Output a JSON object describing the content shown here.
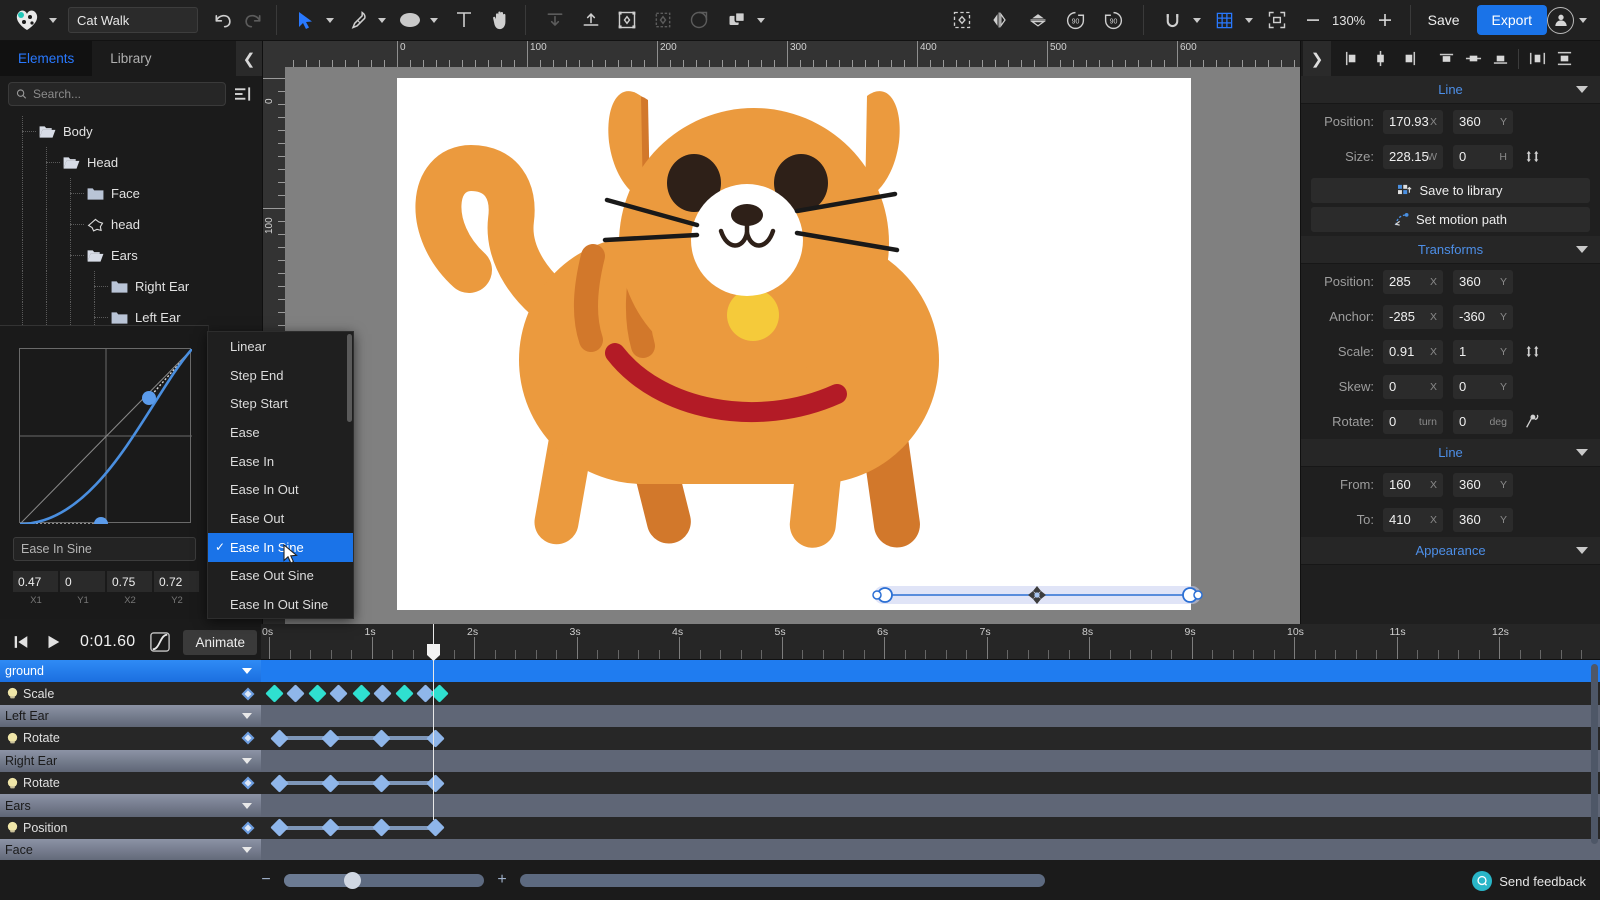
{
  "app": {
    "project_title": "Cat Walk",
    "save_label": "Save",
    "export_label": "Export",
    "zoom_level": "130%",
    "zoom_minus": "−",
    "zoom_plus": "+"
  },
  "left_panel": {
    "tabs": [
      {
        "label": "Elements",
        "selected": true
      },
      {
        "label": "Library",
        "selected": false
      }
    ],
    "search_placeholder": "Search...",
    "search_value": "",
    "tree": [
      {
        "label": "Body",
        "depth": 0,
        "icon": "folder-open-icon"
      },
      {
        "label": "Head",
        "depth": 1,
        "icon": "folder-open-icon"
      },
      {
        "label": "Face",
        "depth": 2,
        "icon": "folder-closed-icon"
      },
      {
        "label": "head",
        "depth": 2,
        "icon": "shape-star-icon"
      },
      {
        "label": "Ears",
        "depth": 2,
        "icon": "folder-open-icon"
      },
      {
        "label": "Right Ear",
        "depth": 3,
        "icon": "folder-closed-icon"
      },
      {
        "label": "Left Ear",
        "depth": 3,
        "icon": "folder-closed-icon"
      }
    ]
  },
  "easing_editor": {
    "name_value": "Ease In Sine",
    "bezier": [
      {
        "value": "0.47",
        "label": "X1"
      },
      {
        "value": "0",
        "label": "Y1"
      },
      {
        "value": "0.75",
        "label": "X2"
      },
      {
        "value": "0.72",
        "label": "Y2"
      }
    ]
  },
  "easing_dropdown": {
    "selected": "Ease In Sine",
    "items": [
      "Linear",
      "Step End",
      "Step Start",
      "Ease",
      "Ease In",
      "Ease In Out",
      "Ease Out",
      "Ease In Sine",
      "Ease Out Sine",
      "Ease In Out Sine"
    ]
  },
  "canvas": {
    "ruler_h_labels": [
      "0",
      "100",
      "200",
      "300",
      "400",
      "500",
      "600"
    ],
    "ruler_v_labels": [
      "0",
      "100"
    ]
  },
  "right_panel": {
    "sections": [
      {
        "title": "Line",
        "rows": [
          {
            "label": "Position:",
            "x": "170.93",
            "y": "360",
            "ux": "X",
            "uy": "Y",
            "link": false
          },
          {
            "label": "Size:",
            "x": "228.15",
            "y": "0",
            "ux": "W",
            "uy": "H",
            "link": true
          }
        ],
        "buttons": [
          {
            "label": "Save to library",
            "icon": "save-library-icon"
          },
          {
            "label": "Set motion path",
            "icon": "motion-path-icon"
          }
        ]
      },
      {
        "title": "Transforms",
        "rows": [
          {
            "label": "Position:",
            "x": "285",
            "y": "360",
            "ux": "X",
            "uy": "Y",
            "link": false
          },
          {
            "label": "Anchor:",
            "x": "-285",
            "y": "-360",
            "ux": "X",
            "uy": "Y",
            "link": false
          },
          {
            "label": "Scale:",
            "x": "0.91",
            "y": "1",
            "ux": "X",
            "uy": "Y",
            "link": true
          },
          {
            "label": "Skew:",
            "x": "0",
            "y": "0",
            "ux": "X",
            "uy": "Y",
            "link": false
          },
          {
            "label": "Rotate:",
            "x": "0",
            "y": "0",
            "ux": "turn",
            "uy": "deg",
            "link": true
          }
        ],
        "buttons": []
      },
      {
        "title": "Line",
        "rows": [
          {
            "label": "From:",
            "x": "160",
            "y": "360",
            "ux": "X",
            "uy": "Y",
            "link": false
          },
          {
            "label": "To:",
            "x": "410",
            "y": "360",
            "ux": "X",
            "uy": "Y",
            "link": false
          }
        ],
        "buttons": []
      },
      {
        "title": "Appearance",
        "rows": [],
        "buttons": []
      }
    ]
  },
  "timeline": {
    "current_time": "0:01.60",
    "animate_label": "Animate",
    "ruler_labels": [
      "0s",
      "1s",
      "2s",
      "3s",
      "4s",
      "5s",
      "6s",
      "7s",
      "8s",
      "9s",
      "10s",
      "11s",
      "12s"
    ],
    "playhead_seconds": 1.6,
    "rows": [
      {
        "name": "ground",
        "type": "group",
        "selected": true
      },
      {
        "name": "Scale",
        "type": "prop",
        "keyframes_s": [
          0.05,
          0.26,
          0.47,
          0.68,
          0.9,
          1.11,
          1.32,
          1.53,
          1.66
        ],
        "alt_colors": true,
        "connect": false
      },
      {
        "name": "Left Ear",
        "type": "group",
        "selected": false
      },
      {
        "name": "Rotate",
        "type": "prop",
        "keyframes_s": [
          0.1,
          0.6,
          1.1,
          1.62
        ],
        "alt_colors": false,
        "connect": true
      },
      {
        "name": "Right Ear",
        "type": "group",
        "selected": false
      },
      {
        "name": "Rotate",
        "type": "prop",
        "keyframes_s": [
          0.1,
          0.6,
          1.1,
          1.62
        ],
        "alt_colors": false,
        "connect": true
      },
      {
        "name": "Ears",
        "type": "group",
        "selected": false
      },
      {
        "name": "Position",
        "type": "prop",
        "keyframes_s": [
          0.1,
          0.6,
          1.1,
          1.62
        ],
        "alt_colors": false,
        "connect": true
      },
      {
        "name": "Face",
        "type": "group",
        "selected": false
      }
    ]
  },
  "footer": {
    "feedback_label": "Send feedback"
  },
  "colors": {
    "accent_blue": "#1a73e8",
    "timeline_blue": "#1f7cf0",
    "keyframe_blue": "#8fb6ea",
    "keyframe_cyan": "#2fe0d0",
    "cat_orange": "#eb9a3e",
    "cat_orange_dark": "#d2782b",
    "collar_red": "#b31b26",
    "bell_yellow": "#f5ca3a"
  }
}
